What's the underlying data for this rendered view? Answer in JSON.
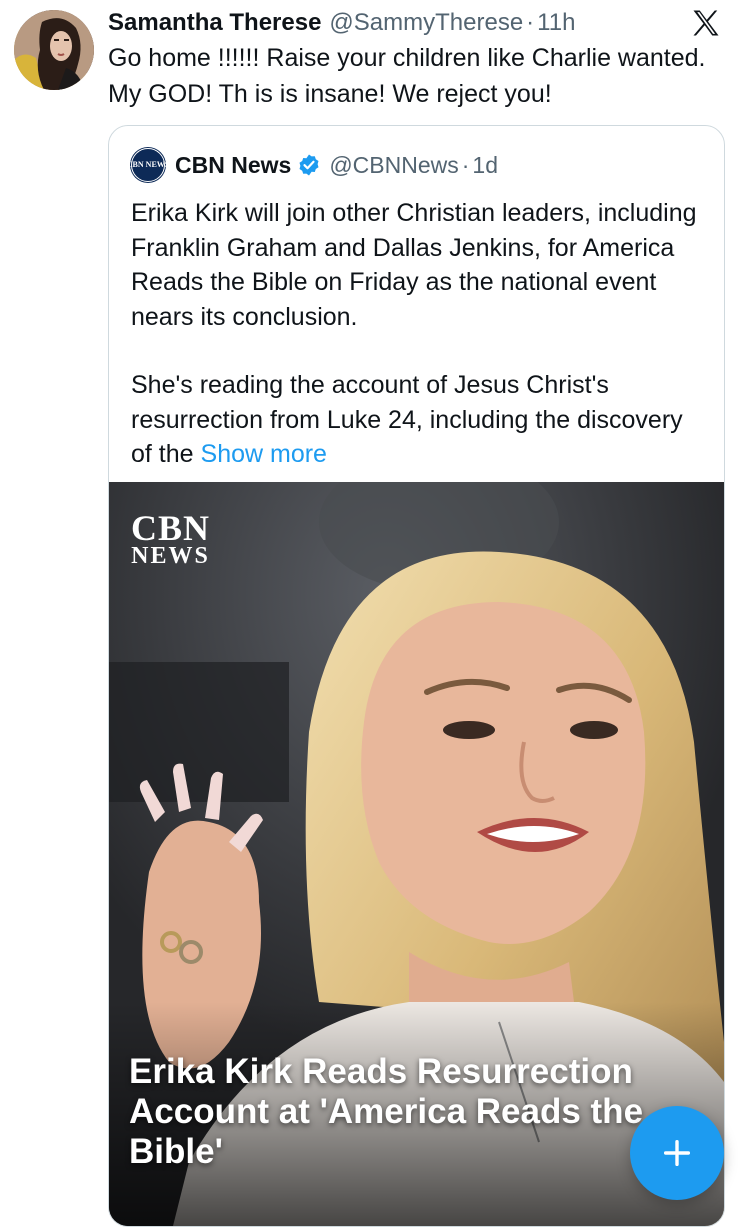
{
  "tweet": {
    "display_name": "Samantha Therese",
    "handle": "@SammyTherese",
    "separator": "·",
    "time": "11h",
    "avatar_icon": "profile-photo",
    "text": "Go home !!!!!! Raise your children like Charlie wanted. My GOD! Th is is insane! We reject you!"
  },
  "platform_icon": "x-logo-icon",
  "quote": {
    "avatar_label": "CBN NEWS",
    "display_name": "CBN News",
    "verified_icon": "verified-badge-icon",
    "handle": "@CBNNews",
    "separator": "·",
    "time": "1d",
    "paragraph1": "Erika Kirk will join other Christian leaders, including Franklin Graham and Dallas Jenkins, for America Reads the Bible on Friday as the national event nears its conclusion.",
    "paragraph2_prefix": "She's reading the account of Jesus Christ's resurrection from Luke 24, including the discovery of the",
    "show_more": "Show more",
    "media": {
      "logo_top": "CBN",
      "logo_bottom": "NEWS",
      "headline": "Erika Kirk Reads Resurrection Account at 'America Reads the Bible'"
    }
  },
  "fab": {
    "icon": "plus-icon"
  },
  "colors": {
    "link": "#1d9bf0",
    "muted": "#536471",
    "border": "#cfd9de",
    "fab": "#1d9bf0"
  }
}
